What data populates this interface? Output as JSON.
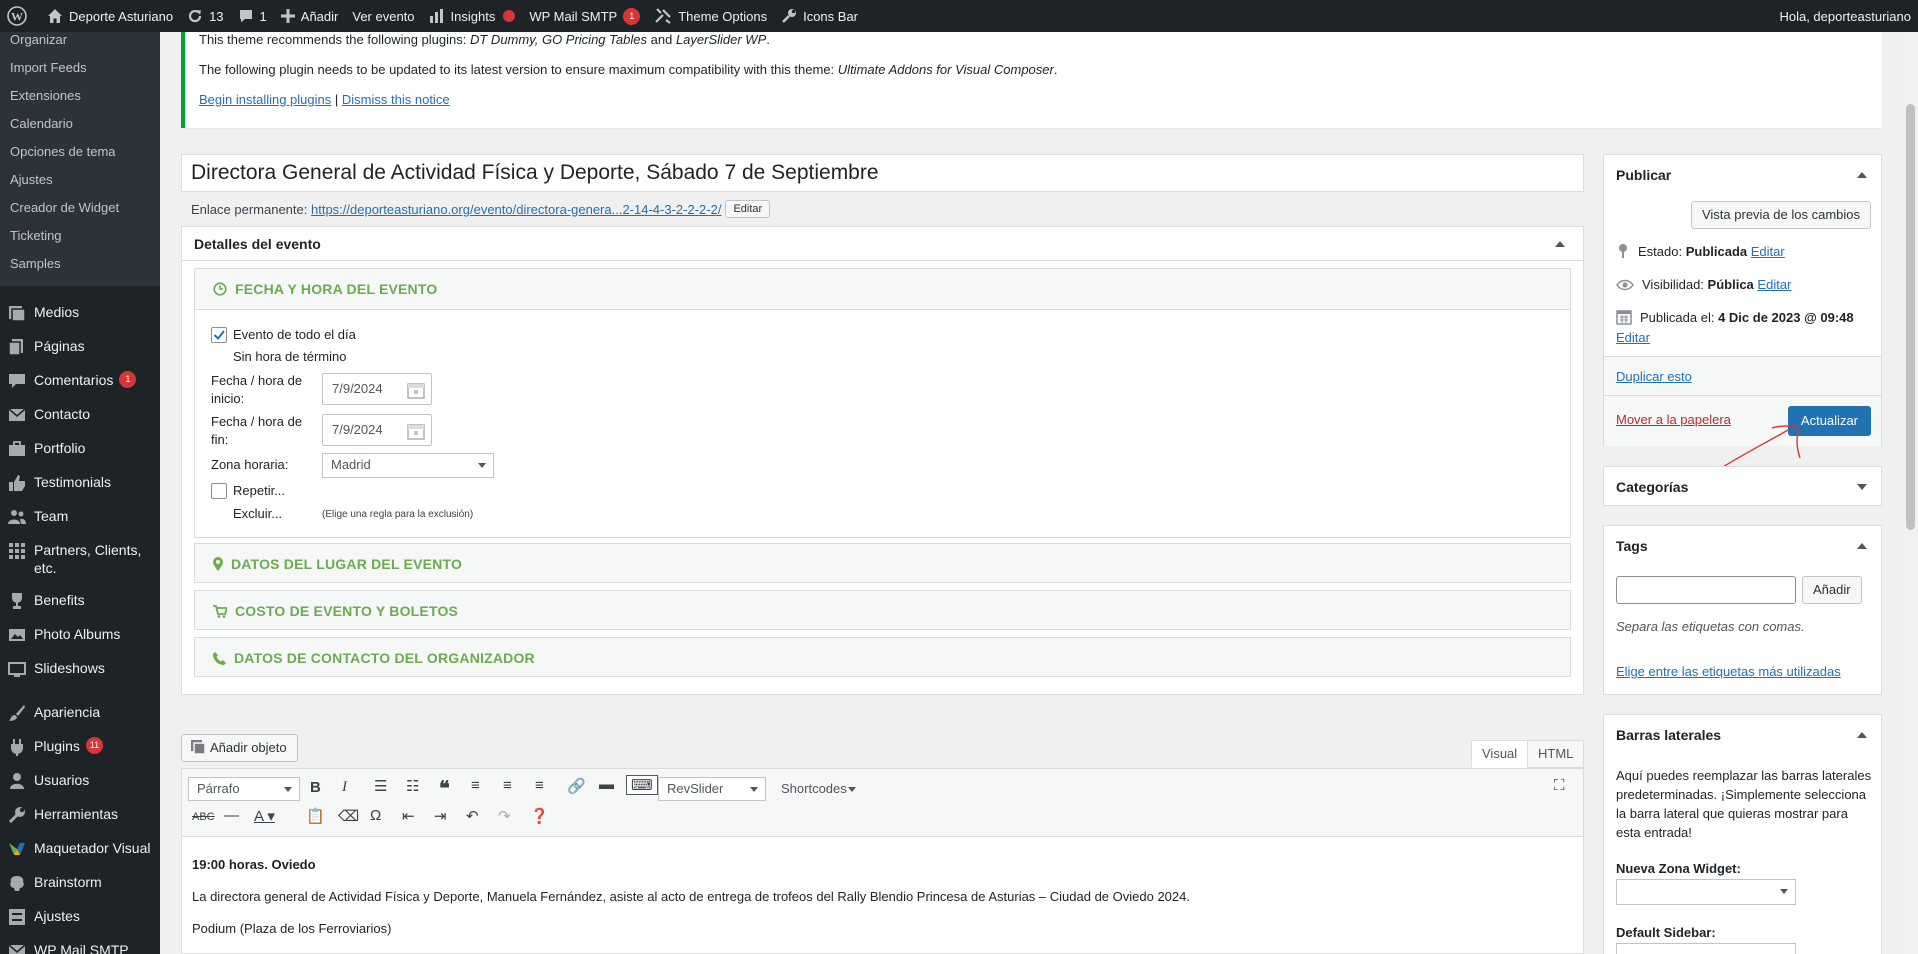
{
  "adminbar": {
    "site_name": "Deporte Asturiano",
    "updates": "13",
    "comments": "1",
    "new": "Añadir",
    "view_event": "Ver evento",
    "insights": "Insights",
    "wp_mail": "WP Mail SMTP",
    "wp_mail_count": "1",
    "theme_options": "Theme Options",
    "icons_bar": "Icons Bar",
    "greeting": "Hola, deporteasturiano"
  },
  "sidebar": {
    "submenu": [
      "Organizar",
      "Import Feeds",
      "Extensiones",
      "Calendario",
      "Opciones de tema",
      "Ajustes",
      "Creador de Widget",
      "Ticketing",
      "Samples"
    ],
    "items": [
      {
        "label": "Medios",
        "icon": "media-icon"
      },
      {
        "label": "Páginas",
        "icon": "pages-icon"
      },
      {
        "label": "Comentarios",
        "icon": "comments-icon",
        "count": "1"
      },
      {
        "label": "Contacto",
        "icon": "mail-icon"
      },
      {
        "label": "Portfolio",
        "icon": "portfolio-icon"
      },
      {
        "label": "Testimonials",
        "icon": "thumbs-up-icon"
      },
      {
        "label": "Team",
        "icon": "team-icon"
      },
      {
        "label": "Partners, Clients, etc.",
        "icon": "grid-icon"
      },
      {
        "label": "Benefits",
        "icon": "trophy-icon"
      },
      {
        "label": "Photo Albums",
        "icon": "photo-icon"
      },
      {
        "label": "Slideshows",
        "icon": "slides-icon"
      },
      {
        "label": "Apariencia",
        "icon": "brush-icon"
      },
      {
        "label": "Plugins",
        "icon": "plugin-icon",
        "count": "11"
      },
      {
        "label": "Usuarios",
        "icon": "users-icon"
      },
      {
        "label": "Herramientas",
        "icon": "wrench-icon"
      },
      {
        "label": "Maquetador Visual",
        "icon": "vc-icon"
      },
      {
        "label": "Brainstorm",
        "icon": "brain-icon"
      },
      {
        "label": "Ajustes",
        "icon": "settings-icon"
      },
      {
        "label": "WP Mail SMTP",
        "icon": "mail-icon"
      }
    ]
  },
  "notice": {
    "line1_prefix": "This theme recommends the following plugins:",
    "line1_p1": "DT Dummy, GO Pricing Tables",
    "line1_and": "and",
    "line1_p2": "LayerSlider WP",
    "line2_prefix": "The following plugin needs to be updated to its latest version to ensure maximum compatibility with this theme:",
    "line2_plugin": "Ultimate Addons for Visual Composer",
    "begin": "Begin installing plugins",
    "sep": "|",
    "dismiss": "Dismiss this notice"
  },
  "post": {
    "title": "Directora General de Actividad Física y Deporte, Sábado 7 de Septiembre",
    "permalink_label": "Enlace permanente:",
    "permalink_base": "https://deporteasturiano.org/evento/",
    "permalink_slug": "directora-genera...2-14-4-3-2-2-2-2/",
    "edit": "Editar"
  },
  "event": {
    "box_title": "Detalles del evento",
    "sec_date": "FECHA Y HORA DEL EVENTO",
    "all_day": "Evento de todo el día",
    "no_end": "Sin hora de término",
    "start_label1": "Fecha / hora de",
    "start_label2": "inicio:",
    "start_value": "7/9/2024",
    "end_label1": "Fecha / hora de",
    "end_label2": "fin:",
    "end_value": "7/9/2024",
    "tz_label": "Zona horaria:",
    "tz_value": "Madrid",
    "repeat": "Repetir...",
    "exclude": "Excluir...",
    "exclude_hint": "(Elige una regla para la exclusión)",
    "sec_venue": "DATOS DEL LUGAR DEL EVENTO",
    "sec_cost": "COSTO DE EVENTO Y BOLETOS",
    "sec_organizer": "DATOS DE CONTACTO DEL ORGANIZADOR"
  },
  "publish": {
    "title": "Publicar",
    "preview": "Vista previa de los cambios",
    "status_label": "Estado:",
    "status_value": "Publicada",
    "edit": "Editar",
    "visibility_label": "Visibilidad:",
    "visibility_value": "Pública",
    "published_label": "Publicada el:",
    "published_value": "4 Dic de 2023 @ 09:48",
    "duplicate": "Duplicar esto",
    "trash": "Mover a la papelera",
    "update": "Actualizar"
  },
  "categories": {
    "title": "Categorías"
  },
  "tags": {
    "title": "Tags",
    "add": "Añadir",
    "hint": "Separa las etiquetas con comas.",
    "choose": "Elige entre las etiquetas más utilizadas"
  },
  "barras": {
    "title": "Barras laterales",
    "desc": [
      "Aquí puedes reemplazar las barras laterales",
      "predeterminadas. ¡Simplemente selecciona",
      "la barra lateral que quieras mostrar para",
      "esta entrada!"
    ],
    "new_zone": "Nueva Zona Widget:",
    "default_sidebar": "Default Sidebar:"
  },
  "editor": {
    "add_media": "Añadir objeto",
    "tab_visual": "Visual",
    "tab_html": "HTML",
    "format": "Párrafo",
    "revslider": "RevSlider",
    "shortcodes": "Shortcodes",
    "line1": "19:00 horas. Oviedo",
    "line2": "La directora general de Actividad Física y Deporte, Manuela Fernández, asiste al acto de entrega de trofeos del Rally Blendio Princesa de Asturias – Ciudad de Oviedo 2024.",
    "line3": "Podium (Plaza de los Ferroviarios)"
  },
  "colors": {
    "accent": "#2271b1",
    "green": "#6bac4f",
    "adminbar": "#1d2327",
    "badge": "#d63638",
    "annotation": "#d63638"
  }
}
